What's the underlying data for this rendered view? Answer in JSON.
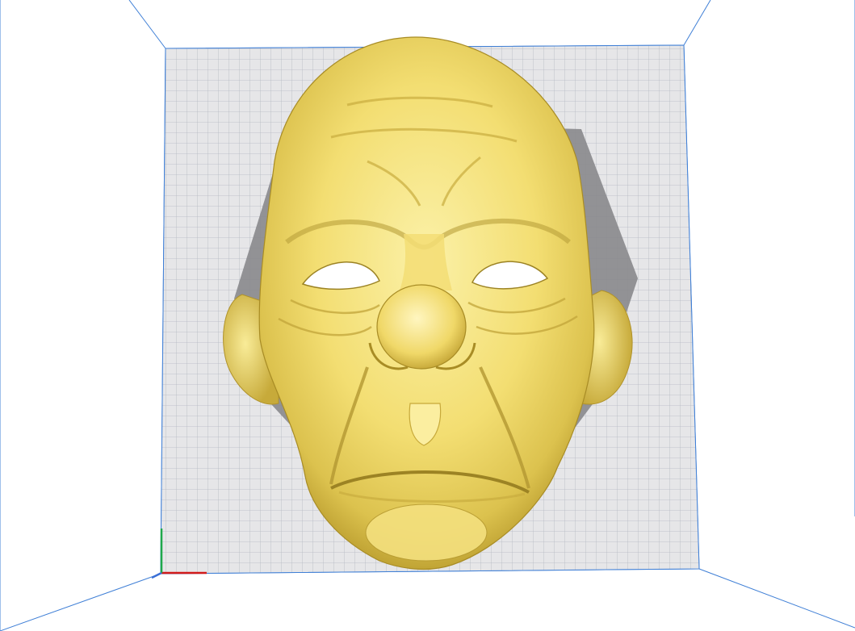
{
  "viewport": {
    "background_color": "#ffffff",
    "volume_edge_color": "#3f7fd6",
    "build_plate_color": "#e6e6e8",
    "grid_line_color": "#b4b8c2",
    "model_color": "#f5e27a",
    "model_shadow_color": "#88888c",
    "model_name": "face-mask-model"
  },
  "axes": {
    "x_axis_color": "#d11a1a",
    "y_axis_color": "#1fa84a",
    "z_axis_color": "#3a6fd6"
  }
}
